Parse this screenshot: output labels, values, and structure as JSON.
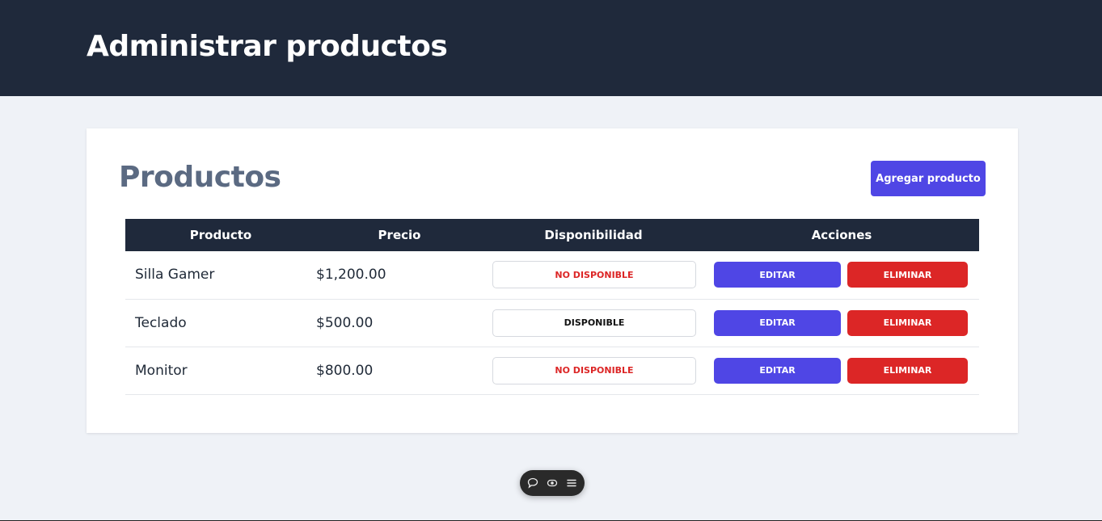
{
  "header": {
    "title": "Administrar productos"
  },
  "card": {
    "title": "Productos",
    "add_button": "Agregar producto"
  },
  "table": {
    "columns": [
      "Producto",
      "Precio",
      "Disponibilidad",
      "Acciones"
    ],
    "rows": [
      {
        "name": "Silla Gamer",
        "price": "$1,200.00",
        "availability": "NO DISPONIBLE",
        "available": false,
        "edit": "EDITAR",
        "delete": "ELIMINAR"
      },
      {
        "name": "Teclado",
        "price": "$500.00",
        "availability": "DISPONIBLE",
        "available": true,
        "edit": "EDITAR",
        "delete": "ELIMINAR"
      },
      {
        "name": "Monitor",
        "price": "$800.00",
        "availability": "NO DISPONIBLE",
        "available": false,
        "edit": "EDITAR",
        "delete": "ELIMINAR"
      }
    ]
  },
  "colors": {
    "header_bg": "#1f293b",
    "primary": "#4f46e5",
    "danger": "#dc2626",
    "page_bg": "#eff2f7"
  },
  "toolbar": {
    "icons": [
      "comment-icon",
      "eye-icon",
      "menu-icon"
    ]
  }
}
